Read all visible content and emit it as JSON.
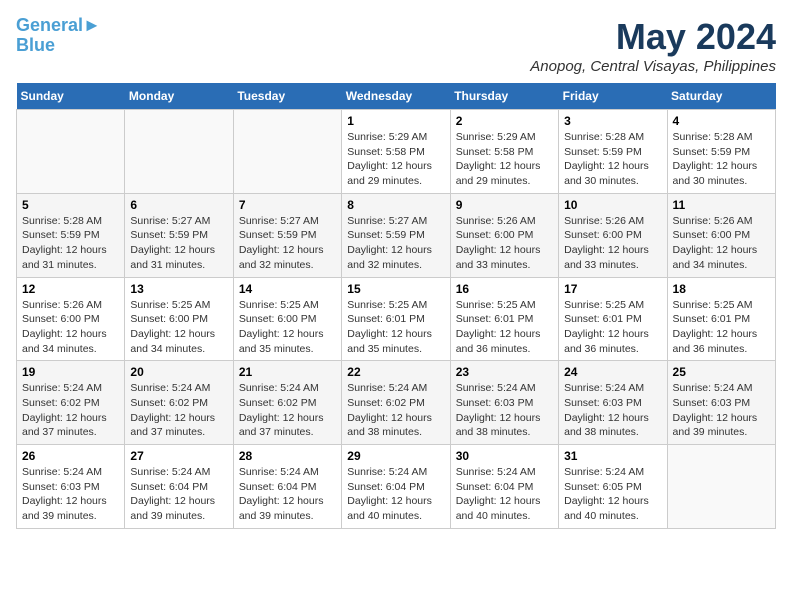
{
  "header": {
    "logo_line1": "General",
    "logo_line2": "Blue",
    "title": "May 2024",
    "subtitle": "Anopog, Central Visayas, Philippines"
  },
  "weekdays": [
    "Sunday",
    "Monday",
    "Tuesday",
    "Wednesday",
    "Thursday",
    "Friday",
    "Saturday"
  ],
  "weeks": [
    [
      {
        "day": "",
        "info": ""
      },
      {
        "day": "",
        "info": ""
      },
      {
        "day": "",
        "info": ""
      },
      {
        "day": "1",
        "info": "Sunrise: 5:29 AM\nSunset: 5:58 PM\nDaylight: 12 hours\nand 29 minutes."
      },
      {
        "day": "2",
        "info": "Sunrise: 5:29 AM\nSunset: 5:58 PM\nDaylight: 12 hours\nand 29 minutes."
      },
      {
        "day": "3",
        "info": "Sunrise: 5:28 AM\nSunset: 5:59 PM\nDaylight: 12 hours\nand 30 minutes."
      },
      {
        "day": "4",
        "info": "Sunrise: 5:28 AM\nSunset: 5:59 PM\nDaylight: 12 hours\nand 30 minutes."
      }
    ],
    [
      {
        "day": "5",
        "info": "Sunrise: 5:28 AM\nSunset: 5:59 PM\nDaylight: 12 hours\nand 31 minutes."
      },
      {
        "day": "6",
        "info": "Sunrise: 5:27 AM\nSunset: 5:59 PM\nDaylight: 12 hours\nand 31 minutes."
      },
      {
        "day": "7",
        "info": "Sunrise: 5:27 AM\nSunset: 5:59 PM\nDaylight: 12 hours\nand 32 minutes."
      },
      {
        "day": "8",
        "info": "Sunrise: 5:27 AM\nSunset: 5:59 PM\nDaylight: 12 hours\nand 32 minutes."
      },
      {
        "day": "9",
        "info": "Sunrise: 5:26 AM\nSunset: 6:00 PM\nDaylight: 12 hours\nand 33 minutes."
      },
      {
        "day": "10",
        "info": "Sunrise: 5:26 AM\nSunset: 6:00 PM\nDaylight: 12 hours\nand 33 minutes."
      },
      {
        "day": "11",
        "info": "Sunrise: 5:26 AM\nSunset: 6:00 PM\nDaylight: 12 hours\nand 34 minutes."
      }
    ],
    [
      {
        "day": "12",
        "info": "Sunrise: 5:26 AM\nSunset: 6:00 PM\nDaylight: 12 hours\nand 34 minutes."
      },
      {
        "day": "13",
        "info": "Sunrise: 5:25 AM\nSunset: 6:00 PM\nDaylight: 12 hours\nand 34 minutes."
      },
      {
        "day": "14",
        "info": "Sunrise: 5:25 AM\nSunset: 6:00 PM\nDaylight: 12 hours\nand 35 minutes."
      },
      {
        "day": "15",
        "info": "Sunrise: 5:25 AM\nSunset: 6:01 PM\nDaylight: 12 hours\nand 35 minutes."
      },
      {
        "day": "16",
        "info": "Sunrise: 5:25 AM\nSunset: 6:01 PM\nDaylight: 12 hours\nand 36 minutes."
      },
      {
        "day": "17",
        "info": "Sunrise: 5:25 AM\nSunset: 6:01 PM\nDaylight: 12 hours\nand 36 minutes."
      },
      {
        "day": "18",
        "info": "Sunrise: 5:25 AM\nSunset: 6:01 PM\nDaylight: 12 hours\nand 36 minutes."
      }
    ],
    [
      {
        "day": "19",
        "info": "Sunrise: 5:24 AM\nSunset: 6:02 PM\nDaylight: 12 hours\nand 37 minutes."
      },
      {
        "day": "20",
        "info": "Sunrise: 5:24 AM\nSunset: 6:02 PM\nDaylight: 12 hours\nand 37 minutes."
      },
      {
        "day": "21",
        "info": "Sunrise: 5:24 AM\nSunset: 6:02 PM\nDaylight: 12 hours\nand 37 minutes."
      },
      {
        "day": "22",
        "info": "Sunrise: 5:24 AM\nSunset: 6:02 PM\nDaylight: 12 hours\nand 38 minutes."
      },
      {
        "day": "23",
        "info": "Sunrise: 5:24 AM\nSunset: 6:03 PM\nDaylight: 12 hours\nand 38 minutes."
      },
      {
        "day": "24",
        "info": "Sunrise: 5:24 AM\nSunset: 6:03 PM\nDaylight: 12 hours\nand 38 minutes."
      },
      {
        "day": "25",
        "info": "Sunrise: 5:24 AM\nSunset: 6:03 PM\nDaylight: 12 hours\nand 39 minutes."
      }
    ],
    [
      {
        "day": "26",
        "info": "Sunrise: 5:24 AM\nSunset: 6:03 PM\nDaylight: 12 hours\nand 39 minutes."
      },
      {
        "day": "27",
        "info": "Sunrise: 5:24 AM\nSunset: 6:04 PM\nDaylight: 12 hours\nand 39 minutes."
      },
      {
        "day": "28",
        "info": "Sunrise: 5:24 AM\nSunset: 6:04 PM\nDaylight: 12 hours\nand 39 minutes."
      },
      {
        "day": "29",
        "info": "Sunrise: 5:24 AM\nSunset: 6:04 PM\nDaylight: 12 hours\nand 40 minutes."
      },
      {
        "day": "30",
        "info": "Sunrise: 5:24 AM\nSunset: 6:04 PM\nDaylight: 12 hours\nand 40 minutes."
      },
      {
        "day": "31",
        "info": "Sunrise: 5:24 AM\nSunset: 6:05 PM\nDaylight: 12 hours\nand 40 minutes."
      },
      {
        "day": "",
        "info": ""
      }
    ]
  ]
}
